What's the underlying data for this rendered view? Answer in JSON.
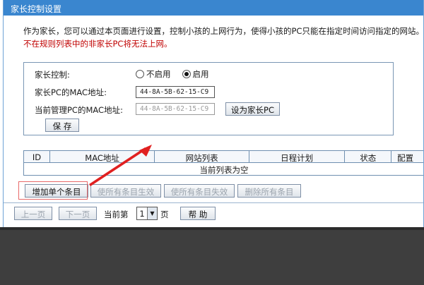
{
  "window": {
    "title": "家长控制设置"
  },
  "intro": {
    "line1": "作为家长，您可以通过本页面进行设置，控制小孩的上网行为，使得小孩的PC只能在指定时间访问指定的网站。",
    "line2_warning": "不在规则列表中的非家长PC将无法上网。"
  },
  "settings": {
    "parental_control_label": "家长控制:",
    "radio_disable_label": "不启用",
    "radio_enable_label": "启用",
    "selected": "启用",
    "parent_mac_label": "家长PC的MAC地址:",
    "parent_mac_value": "44-8A-5B-62-15-C9",
    "current_mac_label": "当前管理PC的MAC地址:",
    "current_mac_value": "44-8A-5B-62-15-C9",
    "set_parent_button": "设为家长PC",
    "save_button": "保 存"
  },
  "rules_table": {
    "columns": [
      "ID",
      "MAC地址",
      "网站列表",
      "日程计划",
      "状态",
      "配置"
    ],
    "empty_text": "当前列表为空"
  },
  "actions": {
    "add_entry": "增加单个条目",
    "enable_all": "使所有条目生效",
    "disable_all": "使所有条目失效",
    "delete_all": "删除所有条目"
  },
  "pagination": {
    "prev": "上一页",
    "next": "下一页",
    "current_page_prefix": "当前第",
    "page_value": "1",
    "page_suffix": "页",
    "help": "帮 助"
  },
  "colors": {
    "titlebar": "#3a86cf",
    "warning_text": "#c00000",
    "annotation_arrow": "#e02020"
  },
  "icons": {
    "arrow": "annotation-arrow-icon",
    "dropdown": "chevron-down-icon"
  }
}
